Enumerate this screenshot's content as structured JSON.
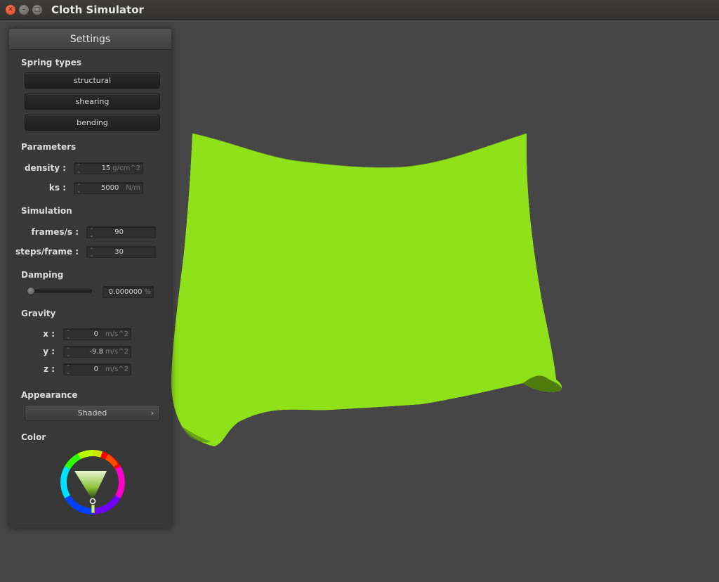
{
  "window": {
    "title": "Cloth Simulator"
  },
  "panel": {
    "title": "Settings",
    "spring_types": {
      "heading": "Spring types",
      "buttons": [
        "structural",
        "shearing",
        "bending"
      ]
    },
    "parameters": {
      "heading": "Parameters",
      "density": {
        "label": "density :",
        "value": "15",
        "unit": "g/cm^2"
      },
      "ks": {
        "label": "ks :",
        "value": "5000",
        "unit": "N/m"
      }
    },
    "simulation": {
      "heading": "Simulation",
      "fps": {
        "label": "frames/s :",
        "value": "90"
      },
      "steps": {
        "label": "steps/frame :",
        "value": "30"
      }
    },
    "damping": {
      "heading": "Damping",
      "slider_fraction": 0.0,
      "value": "0.000000",
      "unit": "%"
    },
    "gravity": {
      "heading": "Gravity",
      "x": {
        "label": "x :",
        "value": "0",
        "unit": "m/s^2"
      },
      "y": {
        "label": "y :",
        "value": "-9.8",
        "unit": "m/s^2"
      },
      "z": {
        "label": "z :",
        "value": "0",
        "unit": "m/s^2"
      }
    },
    "appearance": {
      "heading": "Appearance",
      "selected": "Shaded",
      "arrow": "›"
    },
    "color": {
      "heading": "Color",
      "selected_color": "#8fe11a"
    }
  },
  "icons": {
    "close": "close-icon",
    "minimize": "minimize-icon",
    "maximize": "maximize-icon",
    "spinner": "spinner-arrows-icon"
  },
  "colors": {
    "cloth": "#8fe11a",
    "cloth_shadow": "#4f7a0c",
    "background": "#464646",
    "panel": "#383838"
  }
}
